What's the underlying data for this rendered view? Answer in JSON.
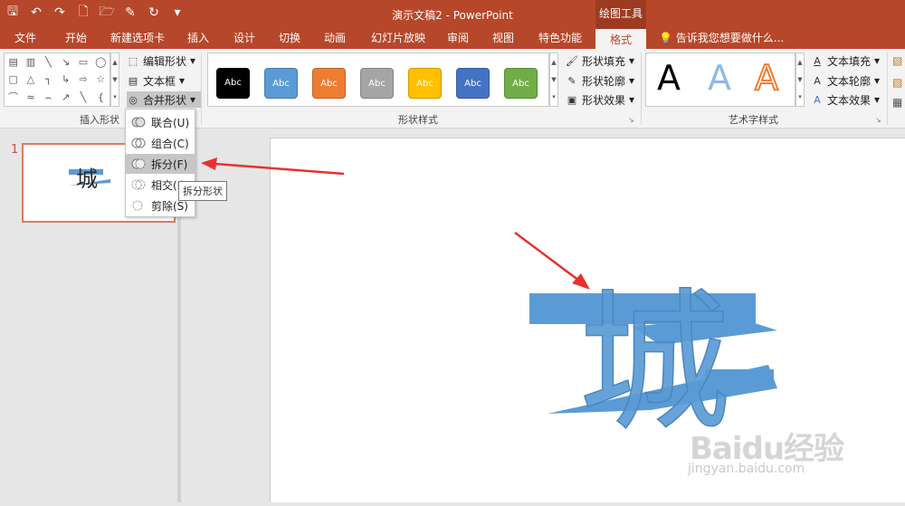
{
  "window": {
    "title": "演示文稿2 - PowerPoint",
    "context_tab_group": "绘图工具",
    "qat_icons": [
      "save-icon",
      "undo-icon",
      "redo-icon",
      "new-icon",
      "open-icon",
      "brush-icon",
      "repeat-icon",
      "qat-dropdown-icon"
    ]
  },
  "tabs": [
    "文件",
    "开始",
    "新建选项卡",
    "插入",
    "设计",
    "切换",
    "动画",
    "幻灯片放映",
    "审阅",
    "视图",
    "特色功能"
  ],
  "active_tab": "格式",
  "tell_me": "告诉我您想要做什么...",
  "ribbon": {
    "insert_shapes": {
      "label": "插入形状",
      "edit_shape": "编辑形状",
      "text_box": "文本框",
      "merge_shapes": "合并形状",
      "dropdown_arrow": "▾"
    },
    "shape_styles": {
      "label": "形状样式",
      "swatch_text": "Abc",
      "swatch_colors": [
        "#000000",
        "#5b9bd5",
        "#ed7d31",
        "#a5a5a5",
        "#ffc000",
        "#4472c4",
        "#70ad47"
      ],
      "fill": "形状填充",
      "outline": "形状轮廓",
      "effects": "形状效果"
    },
    "wordart": {
      "label": "艺术字样式",
      "letter": "A",
      "text_fill": "文本填充",
      "text_outline": "文本轮廓",
      "text_effects": "文本效果"
    }
  },
  "merge_menu": {
    "items": [
      "联合(U)",
      "组合(C)",
      "拆分(F)",
      "相交(I)",
      "剪除(S)"
    ],
    "highlighted": "拆分(F)",
    "tooltip": "拆分形状"
  },
  "slides": {
    "number": "1",
    "character": "城"
  },
  "accent": "#b7472a",
  "shape_color": "#5b9bd5",
  "watermark": {
    "brand": "Baidu经验",
    "url": "jingyan.baidu.com"
  }
}
